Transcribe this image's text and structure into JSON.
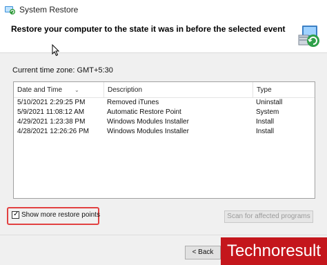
{
  "window": {
    "title": "System Restore",
    "heading": "Restore your computer to the state it was in before the selected event"
  },
  "timezone_text": "Current time zone: GMT+5:30",
  "table": {
    "columns": [
      "Date and Time",
      "Description",
      "Type"
    ],
    "rows": [
      {
        "date": "5/10/2021 2:29:25 PM",
        "description": "Removed iTunes",
        "type": "Uninstall"
      },
      {
        "date": "5/9/2021 11:08:12 AM",
        "description": "Automatic Restore Point",
        "type": "System"
      },
      {
        "date": "4/29/2021 1:23:38 PM",
        "description": "Windows Modules Installer",
        "type": "Install"
      },
      {
        "date": "4/28/2021 12:26:26 PM",
        "description": "Windows Modules Installer",
        "type": "Install"
      }
    ]
  },
  "show_more": {
    "label": "Show more restore points",
    "checked": true
  },
  "scan_button": {
    "label": "Scan for affected programs",
    "enabled": false
  },
  "back_button": {
    "label": "< Back"
  },
  "watermark": "Technoresult",
  "colors": {
    "highlight": "#e24040",
    "watermark_bg": "#c4161c"
  },
  "icons": [
    "system-restore-icon",
    "restore-wizard-icon",
    "mouse-cursor-icon",
    "sort-arrow-icon",
    "checkmark-icon"
  ]
}
